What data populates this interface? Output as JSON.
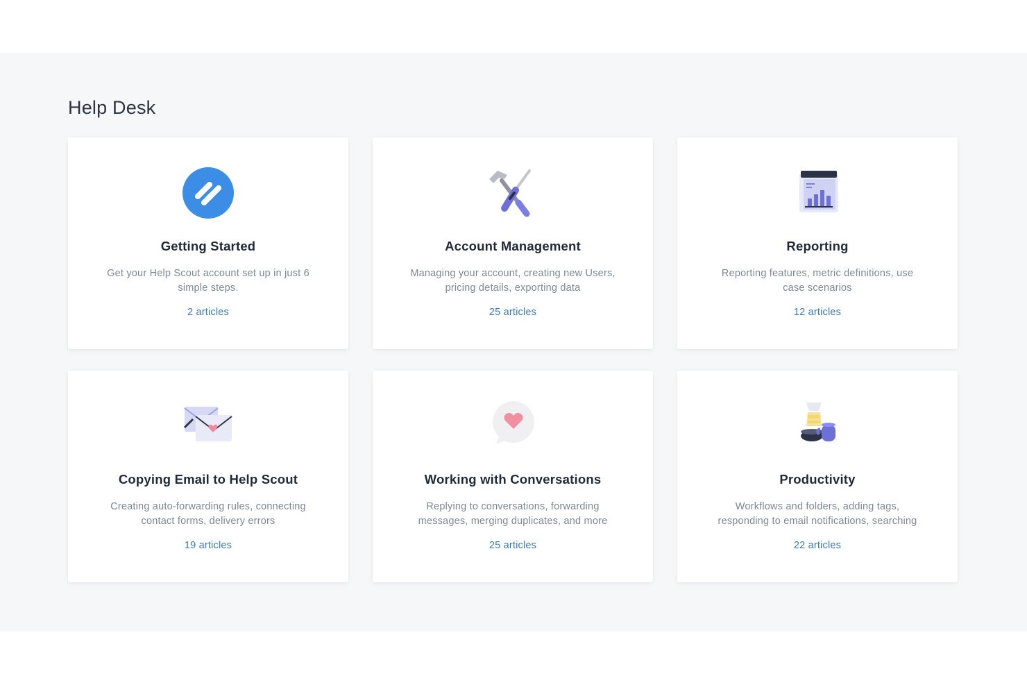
{
  "section": {
    "title": "Help Desk"
  },
  "colors": {
    "page_background": "#f6f7f9",
    "card_background": "#ffffff",
    "title_text": "#1f2a37",
    "description_text": "#7d8793",
    "link_text": "#3b78b8",
    "brand_blue": "#3b8de6"
  },
  "categories": [
    {
      "icon": "help-scout-logo-icon",
      "title": "Getting Started",
      "description": "Get your Help Scout account set up in just 6 simple steps.",
      "count": "2 articles"
    },
    {
      "icon": "hammer-screwdriver-icon",
      "title": "Account Management",
      "description": "Managing your account, creating new Users, pricing details, exporting data",
      "count": "25 articles"
    },
    {
      "icon": "calendar-chart-icon",
      "title": "Reporting",
      "description": "Reporting features, metric definitions, use case scenarios",
      "count": "12 articles"
    },
    {
      "icon": "envelope-heart-icon",
      "title": "Copying Email to Help Scout",
      "description": "Creating auto-forwarding rules, connecting contact forms, delivery errors",
      "count": "19 articles"
    },
    {
      "icon": "speech-bubble-heart-icon",
      "title": "Working with Conversations",
      "description": "Replying to conversations, forwarding messages, merging duplicates, and more",
      "count": "25 articles"
    },
    {
      "icon": "coffee-maker-mug-icon",
      "title": "Productivity",
      "description": "Workflows and folders, adding tags, responding to email notifications, searching",
      "count": "22 articles"
    }
  ]
}
